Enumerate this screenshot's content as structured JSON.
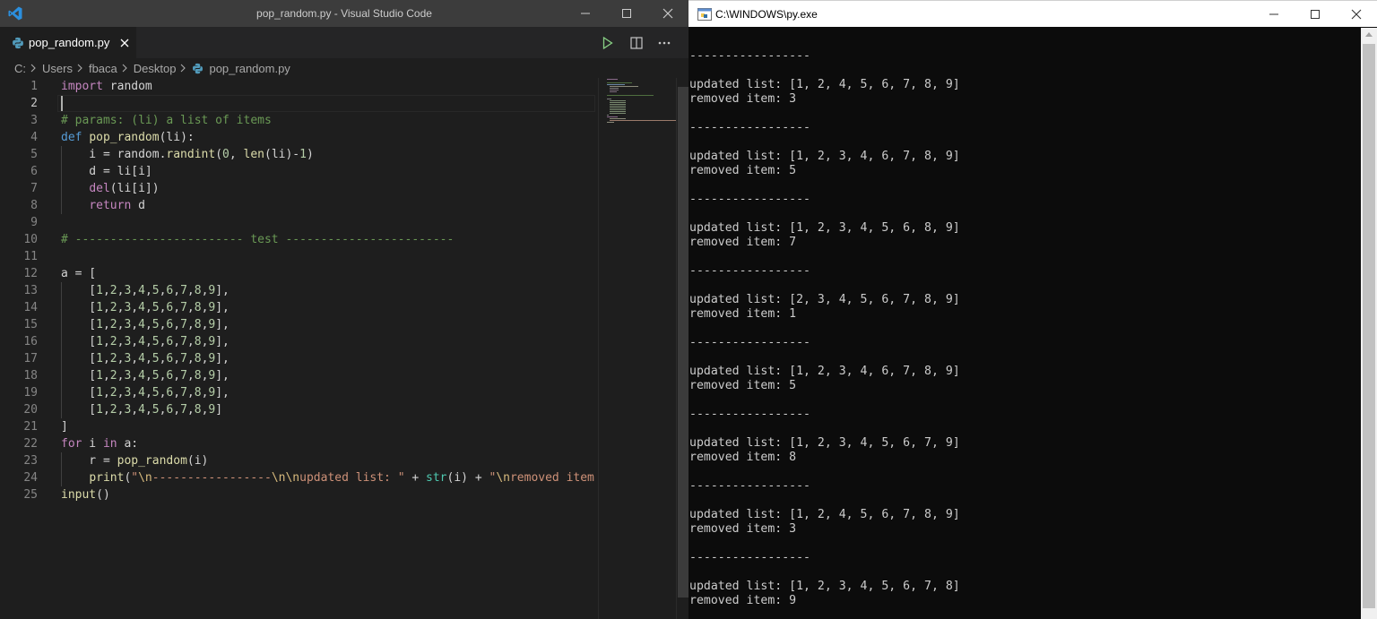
{
  "vscode": {
    "window_title": "pop_random.py - Visual Studio Code",
    "tab": {
      "label": "pop_random.py"
    },
    "breadcrumb": [
      "C:",
      "Users",
      "fbaca",
      "Desktop",
      "pop_random.py"
    ],
    "active_line": 2,
    "code_lines": [
      [
        [
          "import",
          "kw"
        ],
        [
          " random",
          ""
        ]
      ],
      [],
      [
        [
          "# params: (li) a list of items",
          "cm"
        ]
      ],
      [
        [
          "def",
          "kw2"
        ],
        [
          " ",
          ""
        ],
        [
          "pop_random",
          "fn"
        ],
        [
          "(li):",
          ""
        ]
      ],
      [
        [
          "    i = random.",
          ""
        ],
        [
          "randint",
          "fn"
        ],
        [
          "(",
          ""
        ],
        [
          "0",
          "num"
        ],
        [
          ", ",
          ""
        ],
        [
          "len",
          "fn"
        ],
        [
          "(li)-",
          ""
        ],
        [
          "1",
          "num"
        ],
        [
          ")",
          ""
        ]
      ],
      [
        [
          "    d = li[i]",
          ""
        ]
      ],
      [
        [
          "    ",
          ""
        ],
        [
          "del",
          "kw"
        ],
        [
          "(li[i])",
          ""
        ]
      ],
      [
        [
          "    ",
          ""
        ],
        [
          "return",
          "kw"
        ],
        [
          " d",
          ""
        ]
      ],
      [],
      [
        [
          "# ------------------------ test ------------------------",
          "cm"
        ]
      ],
      [],
      [
        [
          "a = [",
          ""
        ]
      ],
      [
        [
          "    [",
          ""
        ],
        [
          "1",
          "num"
        ],
        [
          ",",
          ""
        ],
        [
          "2",
          "num"
        ],
        [
          ",",
          ""
        ],
        [
          "3",
          "num"
        ],
        [
          ",",
          ""
        ],
        [
          "4",
          "num"
        ],
        [
          ",",
          ""
        ],
        [
          "5",
          "num"
        ],
        [
          ",",
          ""
        ],
        [
          "6",
          "num"
        ],
        [
          ",",
          ""
        ],
        [
          "7",
          "num"
        ],
        [
          ",",
          ""
        ],
        [
          "8",
          "num"
        ],
        [
          ",",
          ""
        ],
        [
          "9",
          "num"
        ],
        [
          "],",
          ""
        ]
      ],
      [
        [
          "    [",
          ""
        ],
        [
          "1",
          "num"
        ],
        [
          ",",
          ""
        ],
        [
          "2",
          "num"
        ],
        [
          ",",
          ""
        ],
        [
          "3",
          "num"
        ],
        [
          ",",
          ""
        ],
        [
          "4",
          "num"
        ],
        [
          ",",
          ""
        ],
        [
          "5",
          "num"
        ],
        [
          ",",
          ""
        ],
        [
          "6",
          "num"
        ],
        [
          ",",
          ""
        ],
        [
          "7",
          "num"
        ],
        [
          ",",
          ""
        ],
        [
          "8",
          "num"
        ],
        [
          ",",
          ""
        ],
        [
          "9",
          "num"
        ],
        [
          "],",
          ""
        ]
      ],
      [
        [
          "    [",
          ""
        ],
        [
          "1",
          "num"
        ],
        [
          ",",
          ""
        ],
        [
          "2",
          "num"
        ],
        [
          ",",
          ""
        ],
        [
          "3",
          "num"
        ],
        [
          ",",
          ""
        ],
        [
          "4",
          "num"
        ],
        [
          ",",
          ""
        ],
        [
          "5",
          "num"
        ],
        [
          ",",
          ""
        ],
        [
          "6",
          "num"
        ],
        [
          ",",
          ""
        ],
        [
          "7",
          "num"
        ],
        [
          ",",
          ""
        ],
        [
          "8",
          "num"
        ],
        [
          ",",
          ""
        ],
        [
          "9",
          "num"
        ],
        [
          "],",
          ""
        ]
      ],
      [
        [
          "    [",
          ""
        ],
        [
          "1",
          "num"
        ],
        [
          ",",
          ""
        ],
        [
          "2",
          "num"
        ],
        [
          ",",
          ""
        ],
        [
          "3",
          "num"
        ],
        [
          ",",
          ""
        ],
        [
          "4",
          "num"
        ],
        [
          ",",
          ""
        ],
        [
          "5",
          "num"
        ],
        [
          ",",
          ""
        ],
        [
          "6",
          "num"
        ],
        [
          ",",
          ""
        ],
        [
          "7",
          "num"
        ],
        [
          ",",
          ""
        ],
        [
          "8",
          "num"
        ],
        [
          ",",
          ""
        ],
        [
          "9",
          "num"
        ],
        [
          "],",
          ""
        ]
      ],
      [
        [
          "    [",
          ""
        ],
        [
          "1",
          "num"
        ],
        [
          ",",
          ""
        ],
        [
          "2",
          "num"
        ],
        [
          ",",
          ""
        ],
        [
          "3",
          "num"
        ],
        [
          ",",
          ""
        ],
        [
          "4",
          "num"
        ],
        [
          ",",
          ""
        ],
        [
          "5",
          "num"
        ],
        [
          ",",
          ""
        ],
        [
          "6",
          "num"
        ],
        [
          ",",
          ""
        ],
        [
          "7",
          "num"
        ],
        [
          ",",
          ""
        ],
        [
          "8",
          "num"
        ],
        [
          ",",
          ""
        ],
        [
          "9",
          "num"
        ],
        [
          "],",
          ""
        ]
      ],
      [
        [
          "    [",
          ""
        ],
        [
          "1",
          "num"
        ],
        [
          ",",
          ""
        ],
        [
          "2",
          "num"
        ],
        [
          ",",
          ""
        ],
        [
          "3",
          "num"
        ],
        [
          ",",
          ""
        ],
        [
          "4",
          "num"
        ],
        [
          ",",
          ""
        ],
        [
          "5",
          "num"
        ],
        [
          ",",
          ""
        ],
        [
          "6",
          "num"
        ],
        [
          ",",
          ""
        ],
        [
          "7",
          "num"
        ],
        [
          ",",
          ""
        ],
        [
          "8",
          "num"
        ],
        [
          ",",
          ""
        ],
        [
          "9",
          "num"
        ],
        [
          "],",
          ""
        ]
      ],
      [
        [
          "    [",
          ""
        ],
        [
          "1",
          "num"
        ],
        [
          ",",
          ""
        ],
        [
          "2",
          "num"
        ],
        [
          ",",
          ""
        ],
        [
          "3",
          "num"
        ],
        [
          ",",
          ""
        ],
        [
          "4",
          "num"
        ],
        [
          ",",
          ""
        ],
        [
          "5",
          "num"
        ],
        [
          ",",
          ""
        ],
        [
          "6",
          "num"
        ],
        [
          ",",
          ""
        ],
        [
          "7",
          "num"
        ],
        [
          ",",
          ""
        ],
        [
          "8",
          "num"
        ],
        [
          ",",
          ""
        ],
        [
          "9",
          "num"
        ],
        [
          "],",
          ""
        ]
      ],
      [
        [
          "    [",
          ""
        ],
        [
          "1",
          "num"
        ],
        [
          ",",
          ""
        ],
        [
          "2",
          "num"
        ],
        [
          ",",
          ""
        ],
        [
          "3",
          "num"
        ],
        [
          ",",
          ""
        ],
        [
          "4",
          "num"
        ],
        [
          ",",
          ""
        ],
        [
          "5",
          "num"
        ],
        [
          ",",
          ""
        ],
        [
          "6",
          "num"
        ],
        [
          ",",
          ""
        ],
        [
          "7",
          "num"
        ],
        [
          ",",
          ""
        ],
        [
          "8",
          "num"
        ],
        [
          ",",
          ""
        ],
        [
          "9",
          "num"
        ],
        [
          "]",
          ""
        ]
      ],
      [
        [
          "]",
          ""
        ]
      ],
      [
        [
          "for",
          "kw"
        ],
        [
          " i ",
          ""
        ],
        [
          "in",
          "kw"
        ],
        [
          " a:",
          ""
        ]
      ],
      [
        [
          "    r = ",
          ""
        ],
        [
          "pop_random",
          "fn"
        ],
        [
          "(i)",
          ""
        ]
      ],
      [
        [
          "    ",
          ""
        ],
        [
          "print",
          "fn"
        ],
        [
          "(",
          ""
        ],
        [
          "\"",
          "str"
        ],
        [
          "\\n",
          "esc"
        ],
        [
          "-----------------",
          "str"
        ],
        [
          "\\n\\n",
          "esc"
        ],
        [
          "updated list: \"",
          "str"
        ],
        [
          " + ",
          ""
        ],
        [
          "str",
          "bi"
        ],
        [
          "(i) + ",
          ""
        ],
        [
          "\"",
          "str"
        ],
        [
          "\\n",
          "esc"
        ],
        [
          "removed item: ",
          "str"
        ]
      ],
      [
        [
          "input",
          "fn"
        ],
        [
          "()",
          ""
        ]
      ]
    ]
  },
  "console": {
    "window_title": "C:\\WINDOWS\\py.exe",
    "lines": [
      "",
      "-----------------",
      "",
      "updated list: [1, 2, 4, 5, 6, 7, 8, 9]",
      "removed item: 3",
      "",
      "-----------------",
      "",
      "updated list: [1, 2, 3, 4, 6, 7, 8, 9]",
      "removed item: 5",
      "",
      "-----------------",
      "",
      "updated list: [1, 2, 3, 4, 5, 6, 8, 9]",
      "removed item: 7",
      "",
      "-----------------",
      "",
      "updated list: [2, 3, 4, 5, 6, 7, 8, 9]",
      "removed item: 1",
      "",
      "-----------------",
      "",
      "updated list: [1, 2, 3, 4, 6, 7, 8, 9]",
      "removed item: 5",
      "",
      "-----------------",
      "",
      "updated list: [1, 2, 3, 4, 5, 6, 7, 9]",
      "removed item: 8",
      "",
      "-----------------",
      "",
      "updated list: [1, 2, 4, 5, 6, 7, 8, 9]",
      "removed item: 3",
      "",
      "-----------------",
      "",
      "updated list: [1, 2, 3, 4, 5, 6, 7, 8]",
      "removed item: 9"
    ]
  }
}
